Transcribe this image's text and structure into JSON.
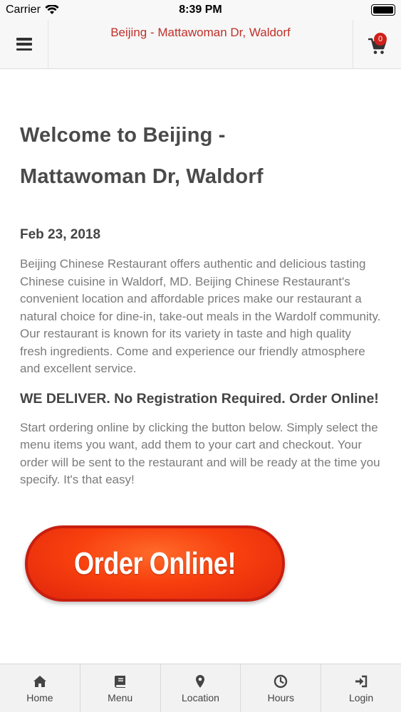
{
  "status_bar": {
    "carrier": "Carrier",
    "time": "8:39 PM"
  },
  "header": {
    "title": "Beijing - Mattawoman Dr, Waldorf",
    "cart_count": "0",
    "title_color": "#c0302a"
  },
  "content": {
    "title_line1": "Welcome to Beijing -",
    "title_line2": "Mattawoman Dr, Waldorf",
    "date": "Feb 23, 2018",
    "body": "Beijing Chinese Restaurant offers authentic and delicious tasting Chinese cuisine in Waldorf, MD.  Beijing Chinese Restaurant's convenient location and affordable prices make our restaurant a natural choice for dine-in, take-out meals in the Wardolf  community. Our restaurant is known for its variety in taste and high quality fresh ingredients. Come and experience our friendly atmosphere and excellent service.",
    "deliver_heading": "WE DELIVER. No Registration Required. Order Online!",
    "instructions": "Start ordering online by clicking the button below. Simply select the menu items you want, add them to your cart and checkout. Your order will be sent to the restaurant and will be ready at the time you specify. It's that easy!",
    "order_button_label": "Order Online!"
  },
  "tabs": [
    {
      "label": "Home",
      "icon": "home-icon"
    },
    {
      "label": "Menu",
      "icon": "book-icon"
    },
    {
      "label": "Location",
      "icon": "map-pin-icon"
    },
    {
      "label": "Hours",
      "icon": "clock-icon"
    },
    {
      "label": "Login",
      "icon": "sign-in-icon"
    }
  ]
}
